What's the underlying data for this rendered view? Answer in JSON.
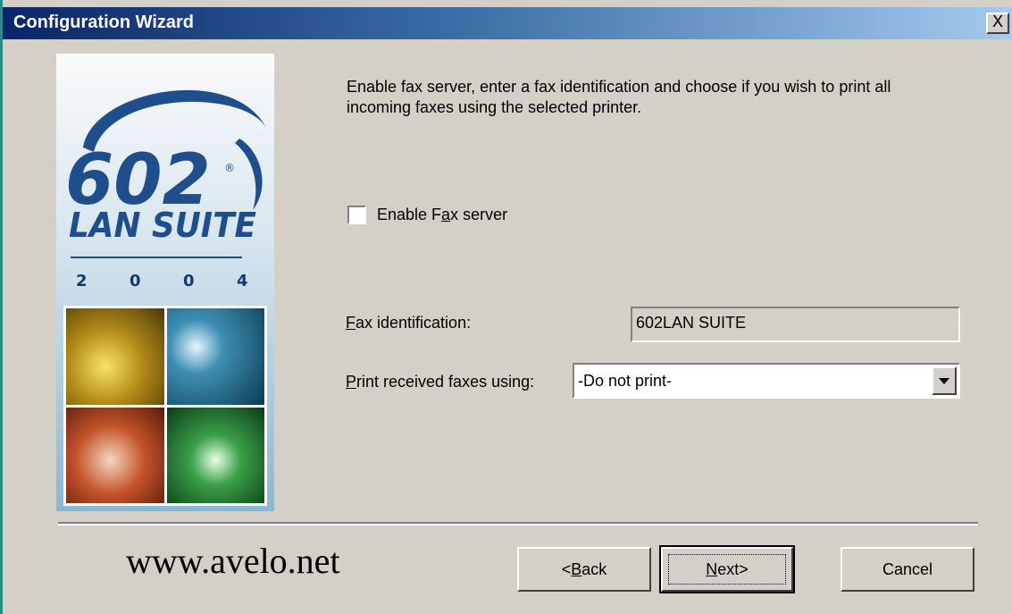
{
  "window": {
    "title": "Configuration Wizard",
    "close_label": "X"
  },
  "logo": {
    "number": "602",
    "registered_mark": "®",
    "product": "LAN SUITE",
    "year_digits": [
      "2",
      "0",
      "0",
      "4"
    ],
    "colors": {
      "brand_blue": "#1f4e8c",
      "year_blue": "#13386e"
    }
  },
  "main": {
    "intro_text": "Enable fax server, enter a fax identification and choose if you wish to print all incoming faxes using the selected printer.",
    "enable_fax_label_pre": "Enable F",
    "enable_fax_label_accel": "a",
    "enable_fax_label_post": "x server",
    "enable_fax_checked": false,
    "fax_id_label_accel": "F",
    "fax_id_label_rest": "ax identification:",
    "fax_id_value": "602LAN SUITE",
    "print_label_accel": "P",
    "print_label_rest": "rint received faxes using:",
    "print_selected": "-Do not print-"
  },
  "footer": {
    "watermark": "www.avelo.net",
    "back_lt": "<",
    "back_accel": "B",
    "back_rest": "ack",
    "next_accel": "N",
    "next_rest": "ext>",
    "cancel_label": "Cancel"
  }
}
